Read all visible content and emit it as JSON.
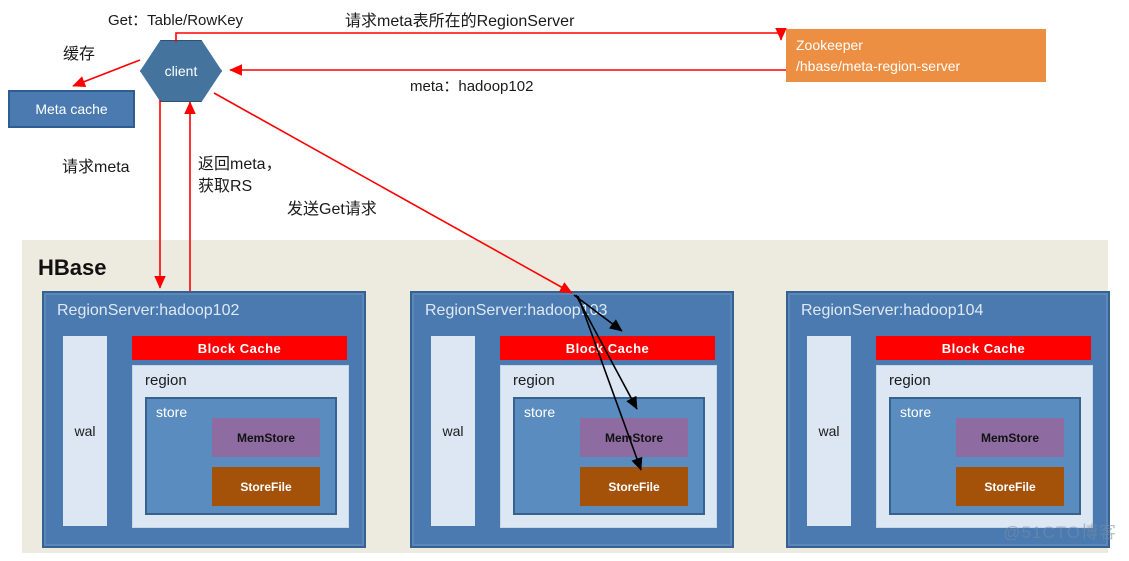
{
  "diagram": {
    "watermark": "@51CTO博客",
    "colors": {
      "client_fill": "#44739e",
      "zookeeper_fill": "#ed8f43",
      "hbase_bg": "#edeae0",
      "regionserver_fill": "#4a7ab0",
      "block_cache_fill": "#ff0000",
      "memstore_fill": "#8e6ca1",
      "storefile_fill": "#a4510a",
      "wal_fill": "#dce7f3",
      "arrow_red": "#ff0000",
      "arrow_black": "#000000"
    }
  },
  "nodes": {
    "client": {
      "label": "client"
    },
    "meta_cache": {
      "label": "Meta cache"
    },
    "zookeeper": {
      "line1": "Zookeeper",
      "line2": "/hbase/meta-region-server"
    },
    "hbase": {
      "title": "HBase"
    }
  },
  "edge_labels": {
    "get_request": "Get：Table/RowKey",
    "cache": "缓存",
    "request_meta_regionserver": "请求meta表所在的RegionServer",
    "meta_hadoop102": "meta：hadoop102",
    "request_meta": "请求meta",
    "return_meta_line1": "返回meta，",
    "return_meta_line2": "获取RS",
    "send_get_request": "发送Get请求"
  },
  "region_servers": [
    {
      "title": "RegionServer:hadoop102",
      "wal": "wal",
      "block_cache": "Block Cache",
      "region": "region",
      "store": "store",
      "memstore": "MemStore",
      "storefile": "StoreFile"
    },
    {
      "title": "RegionServer:hadoop103",
      "wal": "wal",
      "block_cache": "Block Cache",
      "region": "region",
      "store": "store",
      "memstore": "MemStore",
      "storefile": "StoreFile"
    },
    {
      "title": "RegionServer:hadoop104",
      "wal": "wal",
      "block_cache": "Block Cache",
      "region": "region",
      "store": "store",
      "memstore": "MemStore",
      "storefile": "StoreFile"
    }
  ]
}
